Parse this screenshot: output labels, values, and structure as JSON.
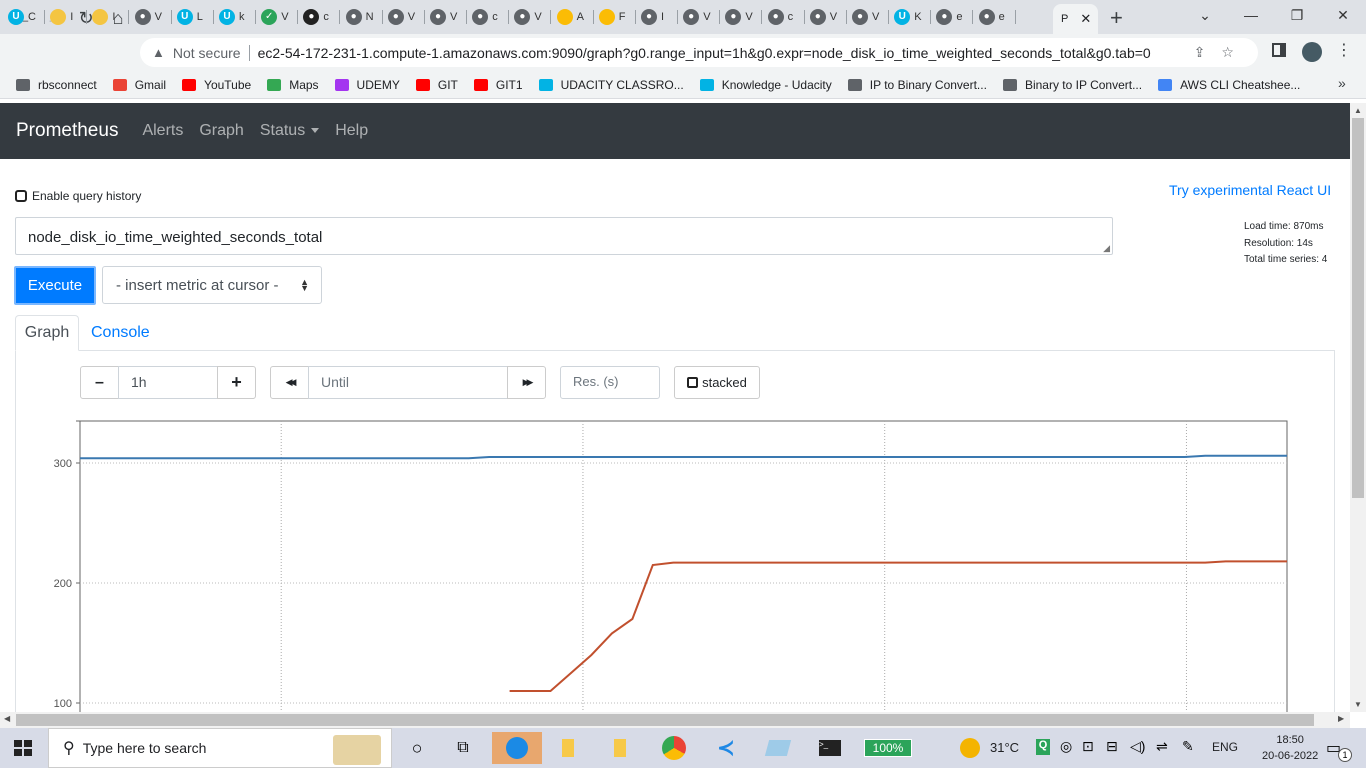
{
  "browser": {
    "tabs": [
      {
        "icon": "udacity-icon",
        "letter": "C"
      },
      {
        "icon": "folder-icon",
        "letter": "I"
      },
      {
        "icon": "folder-icon",
        "letter": "I"
      },
      {
        "icon": "globe-icon",
        "letter": "V"
      },
      {
        "icon": "udacity-icon",
        "letter": "L"
      },
      {
        "icon": "udacity-icon",
        "letter": "k"
      },
      {
        "icon": "check-icon",
        "letter": "V"
      },
      {
        "icon": "github-icon",
        "letter": "c"
      },
      {
        "icon": "globe-icon",
        "letter": "N"
      },
      {
        "icon": "globe-icon",
        "letter": "V"
      },
      {
        "icon": "globe-icon",
        "letter": "V"
      },
      {
        "icon": "globe-icon",
        "letter": "c"
      },
      {
        "icon": "globe-icon",
        "letter": "V"
      },
      {
        "icon": "drive-icon",
        "letter": "A"
      },
      {
        "icon": "drive-icon",
        "letter": "F"
      },
      {
        "icon": "globe-icon",
        "letter": "I"
      },
      {
        "icon": "globe-icon",
        "letter": "V"
      },
      {
        "icon": "globe-icon",
        "letter": "V"
      },
      {
        "icon": "globe-icon",
        "letter": "c"
      },
      {
        "icon": "globe-icon",
        "letter": "V"
      },
      {
        "icon": "globe-icon",
        "letter": "V"
      },
      {
        "icon": "udacity-icon",
        "letter": "K"
      },
      {
        "icon": "globe-icon",
        "letter": "e"
      },
      {
        "icon": "globe-icon",
        "letter": "e"
      }
    ],
    "active_tab_letter": "P",
    "new_tab": "+",
    "url_secure_label": "Not secure",
    "url": "ec2-54-172-231-1.compute-1.amazonaws.com:9090/graph?g0.range_input=1h&g0.expr=node_disk_io_time_weighted_seconds_total&g0.tab=0",
    "bookmarks": [
      {
        "label": "rbsconnect",
        "color": "#5f6368"
      },
      {
        "label": "Gmail",
        "color": "#ea4335"
      },
      {
        "label": "YouTube",
        "color": "#ff0000"
      },
      {
        "label": "Maps",
        "color": "#34a853"
      },
      {
        "label": "UDEMY",
        "color": "#a435f0"
      },
      {
        "label": "GIT",
        "color": "#ff0000"
      },
      {
        "label": "GIT1",
        "color": "#ff0000"
      },
      {
        "label": "UDACITY CLASSRO...",
        "color": "#02b3e4"
      },
      {
        "label": "Knowledge - Udacity",
        "color": "#02b3e4"
      },
      {
        "label": "IP to Binary Convert...",
        "color": "#5f6368"
      },
      {
        "label": "Binary to IP Convert...",
        "color": "#5f6368"
      },
      {
        "label": "AWS CLI Cheatshee...",
        "color": "#4285f4"
      }
    ],
    "bookmarks_more": "»"
  },
  "prometheus": {
    "brand": "Prometheus",
    "nav": [
      "Alerts",
      "Graph",
      "Status",
      "Help"
    ],
    "enable_history_label": "Enable query history",
    "react_ui_link": "Try experimental React UI",
    "query": "node_disk_io_time_weighted_seconds_total",
    "load_time": "Load time: 870ms",
    "resolution": "Resolution: 14s",
    "total_series": "Total time series: 4",
    "execute_label": "Execute",
    "insert_metric_label": "- insert metric at cursor -",
    "tab_graph": "Graph",
    "tab_console": "Console",
    "range_minus": "–",
    "range_value": "1h",
    "range_plus": "+",
    "back": "◀◀",
    "until_placeholder": "Until",
    "forward": "▶▶",
    "res_placeholder": "Res. (s)",
    "stacked_label": "stacked"
  },
  "chart_data": {
    "type": "line",
    "ylim": [
      85,
      335
    ],
    "yticks": [
      300,
      200,
      100
    ],
    "x_slots": 60,
    "series": [
      {
        "color": "#3a78b0",
        "values": [
          304,
          304,
          304,
          304,
          304,
          304,
          304,
          304,
          304,
          304,
          304,
          304,
          304,
          304,
          304,
          304,
          304,
          304,
          304,
          304,
          305,
          305,
          305,
          305,
          305,
          305,
          305,
          305,
          305,
          305,
          305,
          305,
          305,
          305,
          305,
          305,
          305,
          305,
          305,
          305,
          305,
          305,
          305,
          305,
          305,
          305,
          305,
          305,
          305,
          305,
          305,
          305,
          305,
          305,
          305,
          306,
          306,
          306,
          306,
          306
        ]
      },
      {
        "color": "#c1502e",
        "values": [
          null,
          null,
          null,
          null,
          null,
          null,
          null,
          null,
          null,
          null,
          null,
          null,
          null,
          null,
          null,
          null,
          null,
          null,
          null,
          null,
          null,
          110,
          110,
          110,
          125,
          140,
          158,
          170,
          215,
          217,
          217,
          217,
          217,
          217,
          217,
          217,
          217,
          217,
          217,
          217,
          217,
          217,
          217,
          217,
          217,
          217,
          217,
          217,
          217,
          217,
          217,
          217,
          217,
          217,
          217,
          217,
          218,
          218,
          218,
          218
        ]
      }
    ]
  },
  "taskbar": {
    "search_placeholder": "Type here to search",
    "battery": "100%",
    "temperature": "31°C",
    "language": "ENG",
    "time": "18:50",
    "date": "20-06-2022",
    "notifications": "1"
  }
}
